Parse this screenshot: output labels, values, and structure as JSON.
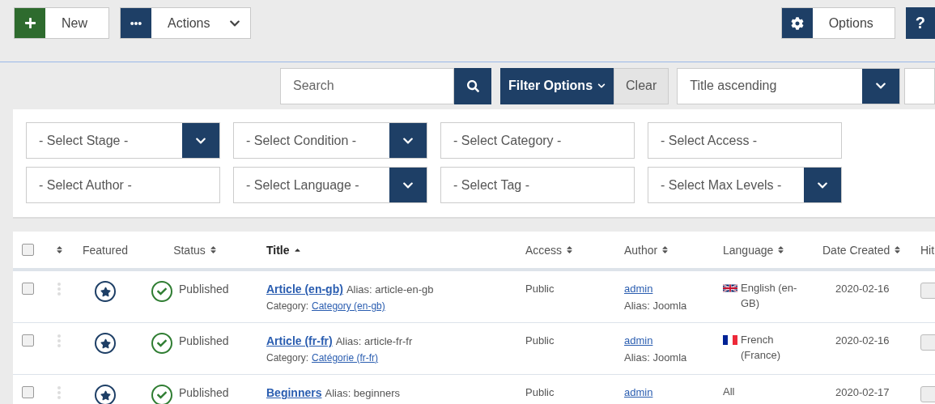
{
  "toolbar": {
    "buttons": [
      {
        "kind": "new",
        "label": "New"
      },
      {
        "kind": "actions",
        "label": "Actions"
      }
    ],
    "right_buttons": [
      {
        "kind": "options",
        "label": "Options"
      },
      {
        "kind": "help",
        "label": "?"
      }
    ]
  },
  "search_bar": {
    "placeholder": "Search",
    "filter_button": "Filter Options",
    "clear_button": "Clear",
    "sort_value": "Title ascending"
  },
  "filters": [
    {
      "placeholder": "- Select Stage -",
      "kind": "dropdown"
    },
    {
      "placeholder": "- Select Condition -",
      "kind": "dropdown"
    },
    {
      "placeholder": "- Select Category -",
      "kind": "plain"
    },
    {
      "placeholder": "- Select Access -",
      "kind": "plain"
    },
    {
      "placeholder": "- Select Author -",
      "kind": "plain"
    },
    {
      "placeholder": "- Select Language -",
      "kind": "dropdown"
    },
    {
      "placeholder": "- Select Tag -",
      "kind": "plain"
    },
    {
      "placeholder": "- Select Max Levels -",
      "kind": "dropdown"
    }
  ],
  "table": {
    "all_checked": false,
    "columns": [
      {
        "label": "Featured",
        "sortable": false,
        "selected": false
      },
      {
        "label": "Status",
        "sortable": true,
        "selected": false
      },
      {
        "label": "Title",
        "sortable": true,
        "selected": true
      },
      {
        "label": "Access",
        "sortable": true,
        "selected": false
      },
      {
        "label": "Author",
        "sortable": true,
        "selected": false
      },
      {
        "label": "Language",
        "sortable": true,
        "selected": false
      },
      {
        "label": "Date Created",
        "sortable": true,
        "selected": false
      },
      {
        "label": "Hit",
        "selected": false
      }
    ],
    "rows": [
      {
        "checked": false,
        "featured": true,
        "status": "Published",
        "published": true,
        "title": "Article (en-gb)",
        "alias": "Alias: article-en-gb",
        "category_label": "Category:",
        "category": "Category (en-gb)",
        "access": "Public",
        "author": "admin",
        "author_alias": "Alias: Joomla",
        "language": {
          "kind": "gb",
          "text": "English (en-GB)"
        },
        "date": "2020-02-16"
      },
      {
        "checked": false,
        "featured": true,
        "status": "Published",
        "published": true,
        "title": "Article (fr-fr)",
        "alias": "Alias: article-fr-fr",
        "category_label": "Category:",
        "category": "Catégorie (fr-fr)",
        "access": "Public",
        "author": "admin",
        "author_alias": "Alias: Joomla",
        "language": {
          "kind": "fr",
          "text": "French (France)"
        },
        "date": "2020-02-16"
      },
      {
        "checked": false,
        "featured": true,
        "status": "Published",
        "published": true,
        "title": "Beginners",
        "alias": "Alias: beginners",
        "access": "Public",
        "author": "admin",
        "language": {
          "kind": "all",
          "text": "All"
        },
        "date": "2020-02-17"
      }
    ]
  }
}
